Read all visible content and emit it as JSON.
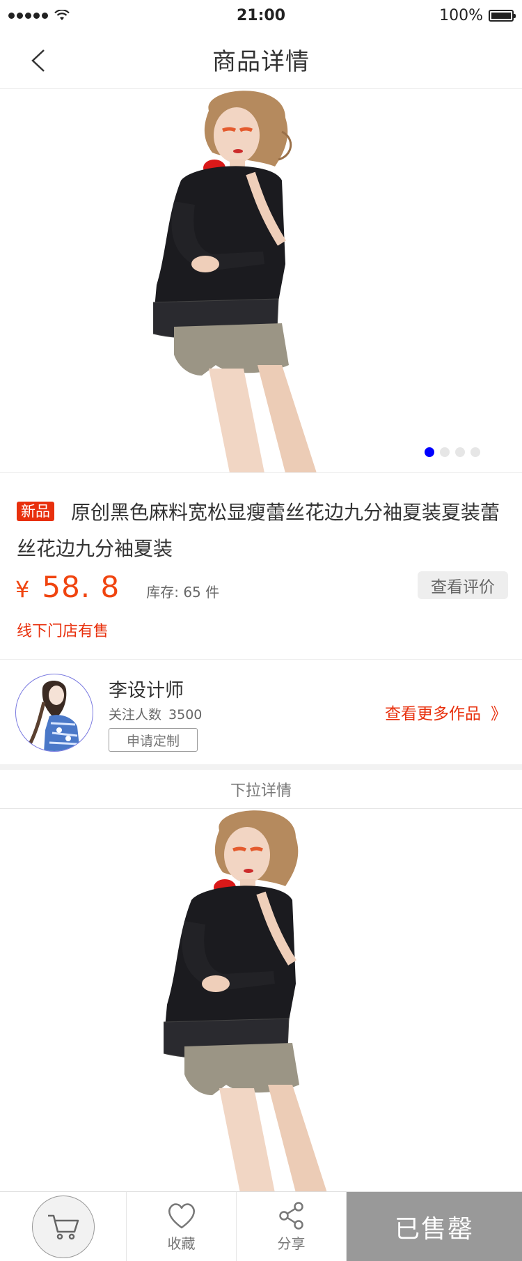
{
  "status_bar": {
    "time": "21:00",
    "battery": "100%"
  },
  "nav": {
    "title": "商品详情",
    "back_icon": "chevron-left-icon"
  },
  "gallery": {
    "page_count": 4,
    "active_index": 0,
    "active_color": "#0000ff"
  },
  "product": {
    "tag": "新品",
    "title": "原创黑色麻料宽松显瘦蕾丝花边九分袖夏装夏装蕾丝花边九分袖夏装",
    "currency": "¥",
    "price": "58. 8",
    "stock_label": "库存: 65 件",
    "review_button": "查看评价",
    "offline_note": "线下门店有售"
  },
  "designer": {
    "name": "李设计师",
    "follow_label": "关注人数",
    "follow_count": "3500",
    "custom_button": "申请定制",
    "more_works": "查看更多作品",
    "more_works_arrow": "》"
  },
  "pull_detail": "下拉详情",
  "bottom_bar": {
    "cart_icon": "cart-icon",
    "favorite_label": "收藏",
    "share_label": "分享",
    "sold_out_label": "已售罄"
  },
  "colors": {
    "accent": "#e8300d",
    "price": "#f0440f",
    "sold_out_bg": "#999999"
  }
}
